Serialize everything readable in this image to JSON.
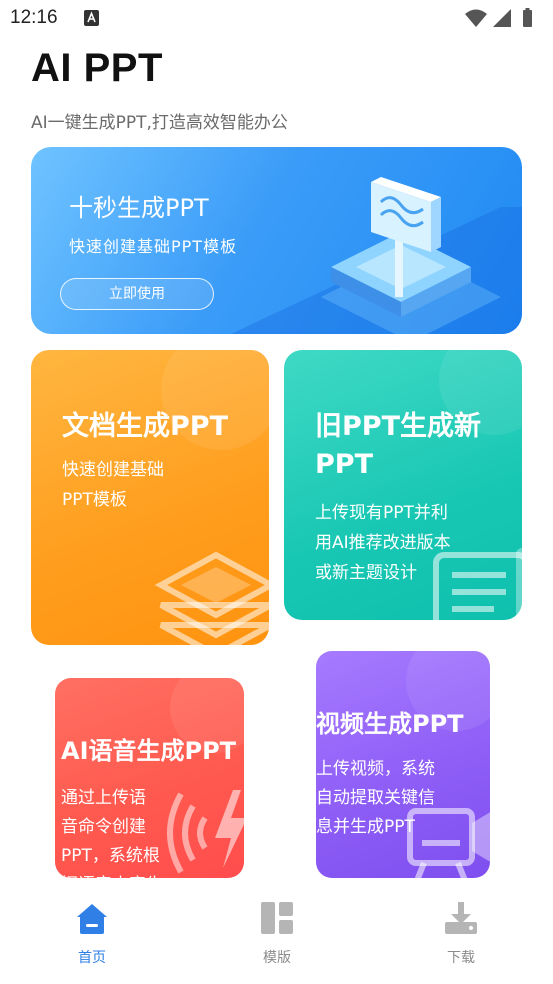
{
  "status_bar": {
    "time": "12:16",
    "notification_icon": "a-badge-icon",
    "right_icons": [
      "wifi-icon",
      "signal-icon",
      "battery-icon"
    ]
  },
  "header": {
    "title": "AI PPT",
    "subtitle": "AI一键生成PPT,打造高效智能办公"
  },
  "hero": {
    "title": "十秒生成PPT",
    "description": "快速创建基础PPT模板",
    "button_label": "立即使用",
    "colors": {
      "start": "#6fc3ff",
      "end": "#1f8af3"
    }
  },
  "cards": {
    "doc": {
      "title": "文档生成PPT",
      "description": "快速创建基础\nPPT模板",
      "icon": "layers-icon",
      "color": "#ff9d1d"
    },
    "old": {
      "title": "旧PPT生成新PPT",
      "description": "上传现有PPT并利\n用AI推荐改进版本\n或新主题设计",
      "icon": "document-icon",
      "color": "#18c7b3"
    },
    "voice": {
      "title": "AI语音生成PPT",
      "description": "通过上传语\n音命令创建\nPPT，系统根\n据语音内容生",
      "icon": "sound-wave-icon",
      "color": "#ff5a4f"
    },
    "video": {
      "title": "视频生成PPT",
      "description": "上传视频，系统\n自动提取关键信\n息并生成PPT",
      "icon": "video-camera-icon",
      "color": "#8f5ef7"
    }
  },
  "tabbar": {
    "active_color": "#2f7fe6",
    "inactive_color": "#8b8b8b",
    "tabs": [
      {
        "label": "首页",
        "icon": "home-icon",
        "active": true
      },
      {
        "label": "模版",
        "icon": "template-grid-icon",
        "active": false
      },
      {
        "label": "下载",
        "icon": "download-icon",
        "active": false
      }
    ]
  }
}
